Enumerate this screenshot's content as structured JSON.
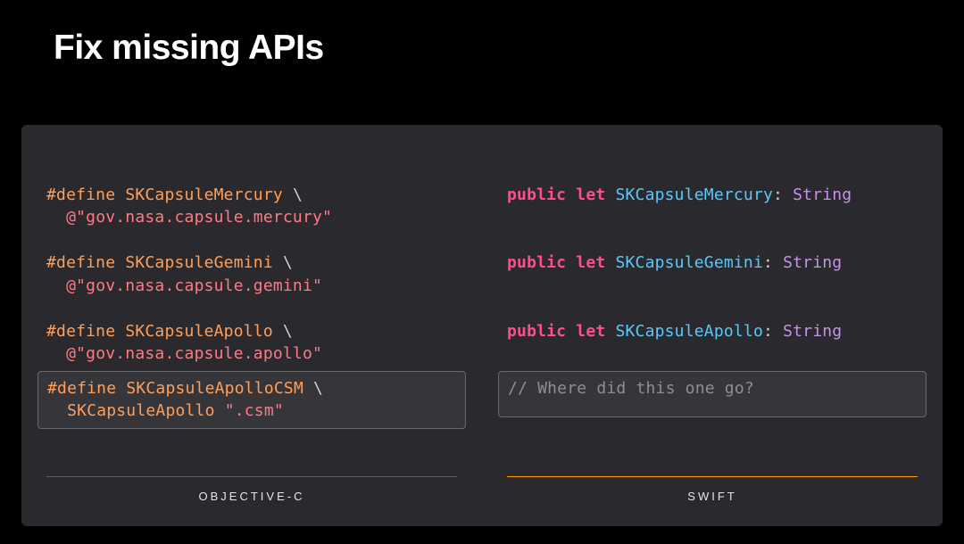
{
  "title": "Fix missing APIs",
  "left": {
    "label": "OBJECTIVE-C",
    "blocks": [
      {
        "kw": "#define",
        "id": "SKCapsuleMercury",
        "cont": "\\",
        "val_prefix": "@",
        "val": "\"gov.nasa.capsule.mercury\""
      },
      {
        "kw": "#define",
        "id": "SKCapsuleGemini",
        "cont": "\\",
        "val_prefix": "@",
        "val": "\"gov.nasa.capsule.gemini\""
      },
      {
        "kw": "#define",
        "id": "SKCapsuleApollo",
        "cont": "\\",
        "val_prefix": "@",
        "val": "\"gov.nasa.capsule.apollo\""
      }
    ],
    "highlighted": {
      "kw": "#define",
      "id": "SKCapsuleApolloCSM",
      "cont": "\\",
      "expr_id": "SKCapsuleApollo",
      "expr_str": "\".csm\""
    }
  },
  "right": {
    "label": "SWIFT",
    "decls": [
      {
        "kw_public": "public",
        "kw_let": "let",
        "name": "SKCapsuleMercury",
        "type": "String"
      },
      {
        "kw_public": "public",
        "kw_let": "let",
        "name": "SKCapsuleGemini",
        "type": "String"
      },
      {
        "kw_public": "public",
        "kw_let": "let",
        "name": "SKCapsuleApollo",
        "type": "String"
      }
    ],
    "highlighted_comment": "// Where did this one go?"
  }
}
